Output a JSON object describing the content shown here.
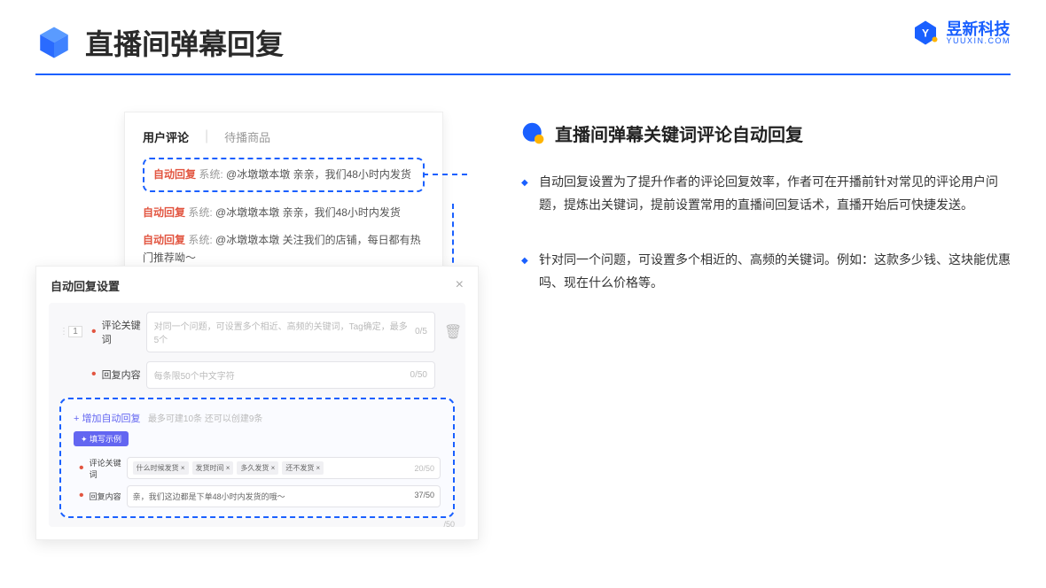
{
  "header": {
    "title": "直播间弹幕回复"
  },
  "brand": {
    "cn": "昱新科技",
    "en": "YUUXIN.COM"
  },
  "comments": {
    "tab_active": "用户评论",
    "tab_other": "待播商品",
    "row1_auto": "自动回复",
    "row1_sys": "系统:",
    "row1_text": "@冰墩墩本墩 亲亲，我们48小时内发货",
    "row2_auto": "自动回复",
    "row2_sys": "系统:",
    "row2_text": "@冰墩墩本墩 亲亲，我们48小时内发货",
    "row3_auto": "自动回复",
    "row3_sys": "系统:",
    "row3_text": "@冰墩墩本墩 关注我们的店铺，每日都有热门推荐呦～"
  },
  "settings": {
    "title": "自动回复设置",
    "order": "1",
    "keyword_label": "评论关键词",
    "keyword_placeholder": "对同一个问题，可设置多个相近、高频的关键词，Tag确定，最多5个",
    "keyword_counter": "0/5",
    "reply_label": "回复内容",
    "reply_placeholder": "每条限50个中文字符",
    "reply_counter": "0/50",
    "add_link": "+ 增加自动回复",
    "add_sub": "最多可建10条 还可以创建9条",
    "example_badge": "✦ 填写示例",
    "ex_kw_label": "评论关键词",
    "ex_tags": [
      "什么时候发货 ×",
      "发货时间 ×",
      "多久发货 ×",
      "还不发货 ×"
    ],
    "ex_kw_counter": "20/50",
    "ex_reply_label": "回复内容",
    "ex_reply_text": "亲，我们这边都是下单48小时内发货的哦～",
    "ex_reply_counter": "37/50",
    "extra_counter": "/50"
  },
  "right": {
    "title": "直播间弹幕关键词评论自动回复",
    "bullet1": "自动回复设置为了提升作者的评论回复效率，作者可在开播前针对常见的评论用户问题，提炼出关键词，提前设置常用的直播间回复话术，直播开始后可快捷发送。",
    "bullet2": "针对同一个问题，可设置多个相近的、高频的关键词。例如：这款多少钱、这块能优惠吗、现在什么价格等。"
  }
}
